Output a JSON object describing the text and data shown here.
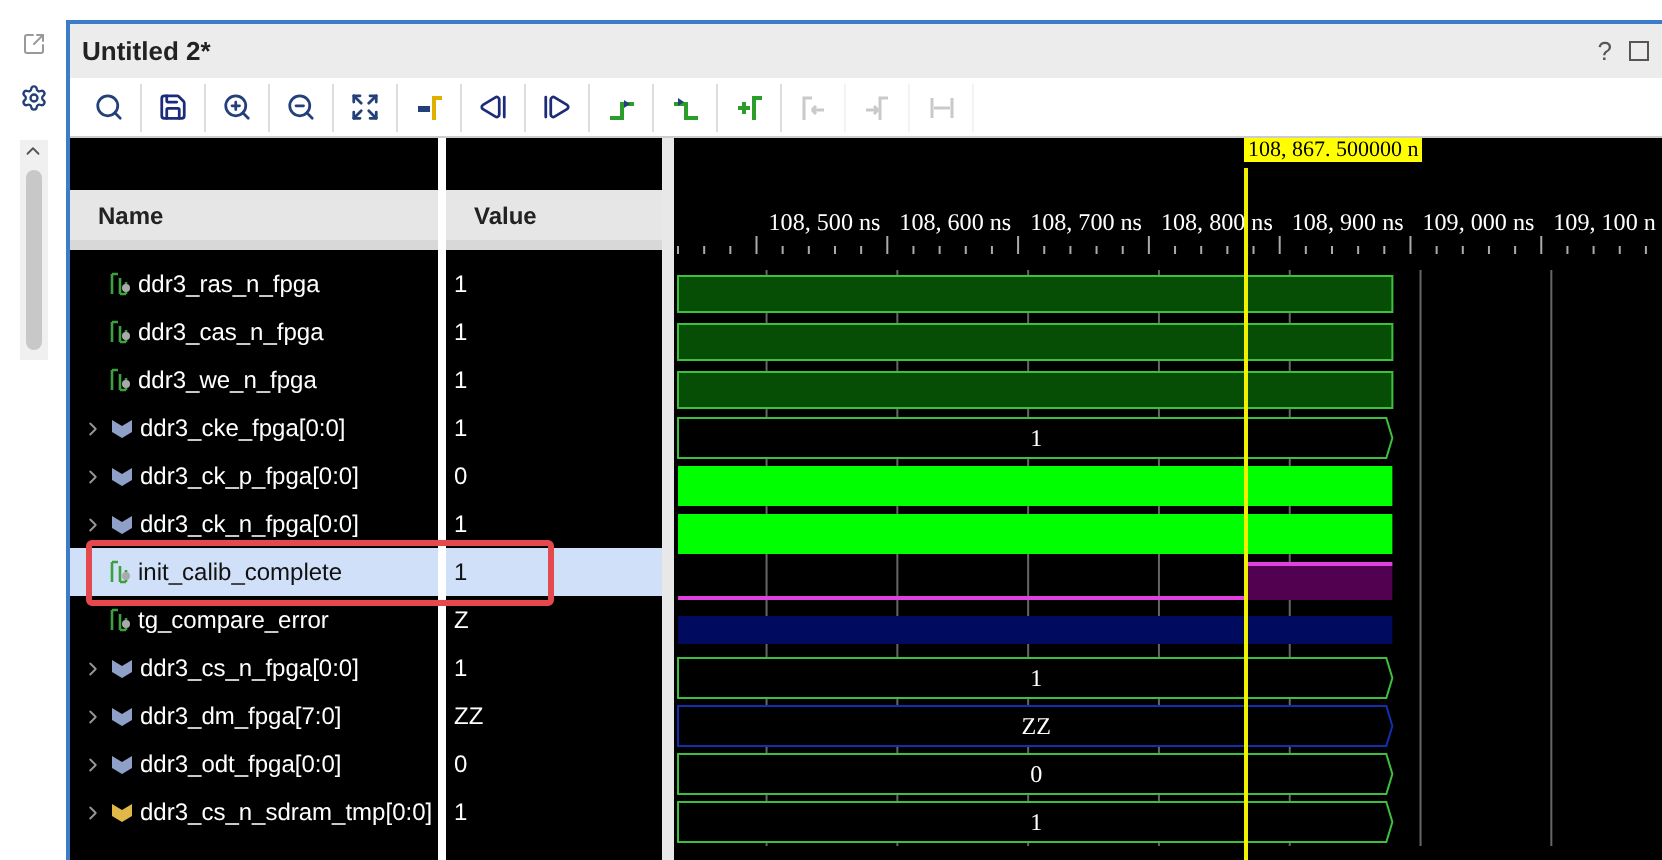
{
  "window": {
    "title": "Untitled 2*",
    "help": "?"
  },
  "toolbar": [
    {
      "kind": "search",
      "disabled": false
    },
    {
      "kind": "save",
      "disabled": false
    },
    {
      "kind": "zoom_in",
      "disabled": false
    },
    {
      "kind": "zoom_out",
      "disabled": false
    },
    {
      "kind": "fit",
      "disabled": false
    },
    {
      "kind": "to_cursor",
      "disabled": false
    },
    {
      "kind": "first",
      "disabled": false
    },
    {
      "kind": "last",
      "disabled": false
    },
    {
      "kind": "prev_edge",
      "disabled": false
    },
    {
      "kind": "next_edge",
      "disabled": false
    },
    {
      "kind": "add_marker",
      "disabled": false
    },
    {
      "kind": "prev_marker",
      "disabled": true
    },
    {
      "kind": "next_marker",
      "disabled": true
    },
    {
      "kind": "swap",
      "disabled": true
    }
  ],
  "columns": [
    "Name",
    "Value"
  ],
  "cursor": {
    "label": "108, 867. 500000 n"
  },
  "ruler": [
    "108, 500 ns",
    "108, 600 ns",
    "108, 700 ns",
    "108, 800 ns",
    "108, 900 ns",
    "109, 000 ns",
    "109, 100 n"
  ],
  "rows": [
    {
      "name": "ddr3_ras_n_fpga",
      "value": "1",
      "kind": "bit",
      "expandable": false,
      "selected": false,
      "wave": {
        "kind": "high"
      }
    },
    {
      "name": "ddr3_cas_n_fpga",
      "value": "1",
      "kind": "bit",
      "expandable": false,
      "selected": false,
      "wave": {
        "kind": "high"
      }
    },
    {
      "name": "ddr3_we_n_fpga",
      "value": "1",
      "kind": "bit",
      "expandable": false,
      "selected": false,
      "wave": {
        "kind": "high"
      }
    },
    {
      "name": "ddr3_cke_fpga[0:0]",
      "value": "1",
      "kind": "bus",
      "expandable": true,
      "selected": false,
      "wave": {
        "kind": "bus",
        "label": "1"
      }
    },
    {
      "name": "ddr3_ck_p_fpga[0:0]",
      "value": "0",
      "kind": "bus",
      "expandable": true,
      "selected": false,
      "wave": {
        "kind": "clock"
      }
    },
    {
      "name": "ddr3_ck_n_fpga[0:0]",
      "value": "1",
      "kind": "bus",
      "expandable": true,
      "selected": false,
      "wave": {
        "kind": "clock"
      }
    },
    {
      "name": "init_calib_complete",
      "value": "1",
      "kind": "bit",
      "expandable": false,
      "selected": true,
      "wave": {
        "kind": "rise"
      }
    },
    {
      "name": "tg_compare_error",
      "value": "Z",
      "kind": "bit",
      "expandable": false,
      "selected": false,
      "wave": {
        "kind": "z"
      }
    },
    {
      "name": "ddr3_cs_n_fpga[0:0]",
      "value": "1",
      "kind": "bus",
      "expandable": true,
      "selected": false,
      "wave": {
        "kind": "bus",
        "label": "1"
      }
    },
    {
      "name": "ddr3_dm_fpga[7:0]",
      "value": "ZZ",
      "kind": "bus",
      "expandable": true,
      "selected": false,
      "wave": {
        "kind": "bus_z",
        "label": "ZZ"
      }
    },
    {
      "name": "ddr3_odt_fpga[0:0]",
      "value": "0",
      "kind": "bus",
      "expandable": true,
      "selected": false,
      "wave": {
        "kind": "bus",
        "label": "0"
      }
    },
    {
      "name": "ddr3_cs_n_sdram_tmp[0:0]",
      "value": "1",
      "kind": "bus_alt",
      "expandable": true,
      "selected": false,
      "wave": {
        "kind": "bus",
        "label": "1"
      }
    }
  ]
}
